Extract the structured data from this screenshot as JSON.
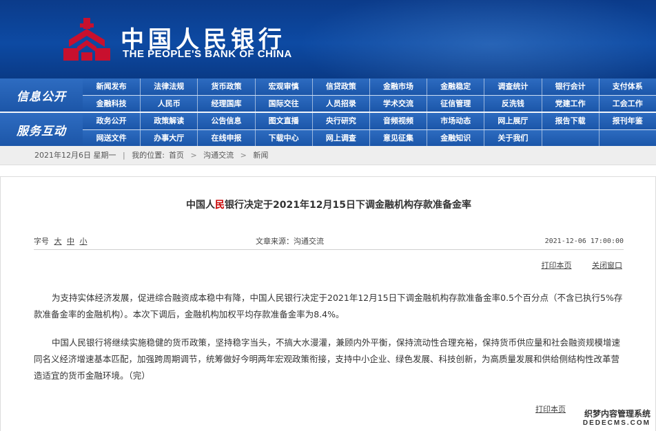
{
  "header": {
    "logo_cn": "中国人民银行",
    "logo_en": "THE PEOPLE'S BANK OF CHINA",
    "emblem_icon": "pboc-emblem-icon",
    "colors": {
      "header_bg": "#0d4aa3",
      "emblem": "#c8102e"
    }
  },
  "nav": {
    "group1": {
      "title": "信息公开",
      "rows": [
        [
          "新闻发布",
          "法律法规",
          "货币政策",
          "宏观审慎",
          "信贷政策",
          "金融市场",
          "金融稳定",
          "调查统计",
          "银行会计",
          "支付体系"
        ],
        [
          "金融科技",
          "人民币",
          "经理国库",
          "国际交往",
          "人员招录",
          "学术交流",
          "征信管理",
          "反洗钱",
          "党建工作",
          "工会工作"
        ]
      ]
    },
    "group2": {
      "title": "服务互动",
      "rows": [
        [
          "政务公开",
          "政策解读",
          "公告信息",
          "图文直播",
          "央行研究",
          "音频视频",
          "市场动态",
          "网上展厅",
          "报告下载",
          "报刊年鉴"
        ],
        [
          "网送文件",
          "办事大厅",
          "在线申报",
          "下载中心",
          "网上调查",
          "意见征集",
          "金融知识",
          "关于我们",
          "",
          ""
        ]
      ]
    }
  },
  "breadcrumb": {
    "date": "2021年12月6日 星期一",
    "sep": "|",
    "location_label": "我的位置:",
    "items": [
      "首页",
      "沟通交流",
      "新闻"
    ]
  },
  "article": {
    "title_pre": "中国人",
    "title_hl": "民",
    "title_post": "银行决定于2021年12月15日下调金融机构存款准备金率",
    "font_label": "字号",
    "font_sizes": [
      "大",
      "中",
      "小"
    ],
    "source": "文章来源：沟通交流",
    "datetime": "2021-12-06 17:00:00",
    "print_label": "打印本页",
    "close_label": "关闭窗口",
    "paragraphs": [
      "为支持实体经济发展，促进综合融资成本稳中有降，中国人民银行决定于2021年12月15日下调金融机构存款准备金率0.5个百分点（不含已执行5%存款准备金率的金融机构）。本次下调后，金融机构加权平均存款准备金率为8.4%。",
      "中国人民银行将继续实施稳健的货币政策，坚持稳字当头，不搞大水漫灌，兼顾内外平衡，保持流动性合理充裕，保持货币供应量和社会融资规模增速同名义经济增速基本匹配，加强跨周期调节，统筹做好今明两年宏观政策衔接，支持中小企业、绿色发展、科技创新，为高质量发展和供给侧结构性改革营造适宜的货币金融环境。（完）"
    ],
    "print_label_bottom": "打印本页"
  },
  "watermark": {
    "line1": "织梦内容管理系统",
    "line2": "DEDECMS.COM"
  }
}
